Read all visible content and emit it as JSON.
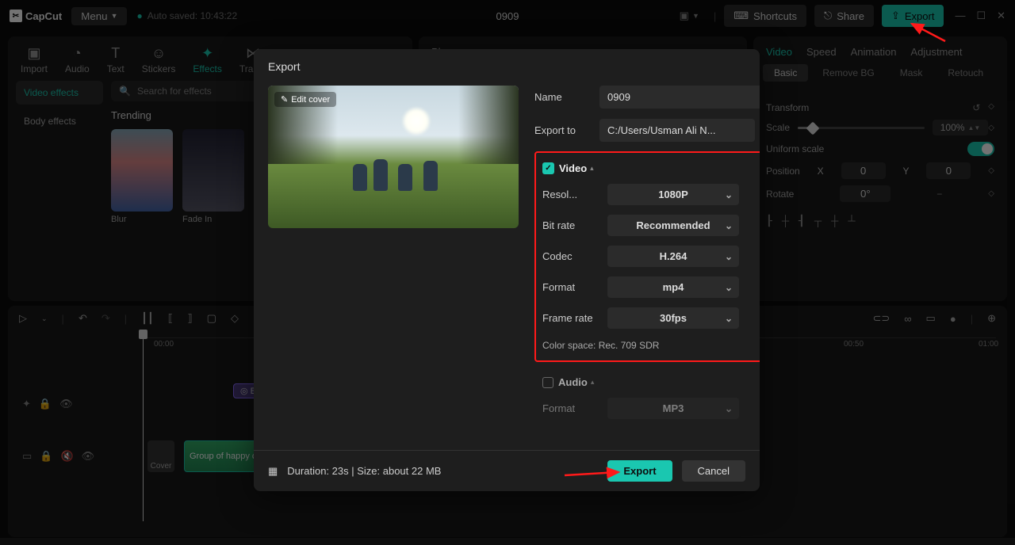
{
  "app": {
    "name": "CapCut",
    "menu": "Menu",
    "autosave": "Auto saved: 10:43:22",
    "title": "0909"
  },
  "topbar": {
    "shortcuts": "Shortcuts",
    "share": "Share",
    "export": "Export"
  },
  "left": {
    "tabs": {
      "import": "Import",
      "audio": "Audio",
      "text": "Text",
      "stickers": "Stickers",
      "effects": "Effects",
      "transitions": "Tran..."
    },
    "side_active": "Video effects",
    "side_body": "Body effects",
    "search_placeholder": "Search for effects",
    "trending": "Trending",
    "thumbs": [
      {
        "name": "blur",
        "label": "Blur"
      },
      {
        "name": "fade-in",
        "label": "Fade In"
      },
      {
        "name": "thumb3",
        "label": ""
      },
      {
        "name": "thumb4",
        "label": ""
      }
    ]
  },
  "player": {
    "label": "Player"
  },
  "right": {
    "tabs": {
      "video": "Video",
      "speed": "Speed",
      "animation": "Animation",
      "adjustment": "Adjustment"
    },
    "subtabs": {
      "basic": "Basic",
      "removebg": "Remove BG",
      "mask": "Mask",
      "retouch": "Retouch"
    },
    "transform": "Transform",
    "scale_label": "Scale",
    "scale_value": "100%",
    "uniform": "Uniform scale",
    "position": "Position",
    "pos_x": "0",
    "pos_y": "0",
    "x": "X",
    "y": "Y",
    "rotate": "Rotate",
    "rotate_val": "0°"
  },
  "timeline": {
    "times": [
      "00:00",
      "00:50",
      "01:00"
    ],
    "cover": "Cover",
    "clip_label": "Group of happy children",
    "pill": "Bl..."
  },
  "modal": {
    "title": "Export",
    "edit_cover": "Edit cover",
    "name_label": "Name",
    "name_value": "0909",
    "exportto_label": "Export to",
    "exportto_value": "C:/Users/Usman Ali N...",
    "video_title": "Video",
    "resolution_label": "Resol...",
    "resolution_value": "1080P",
    "bitrate_label": "Bit rate",
    "bitrate_value": "Recommended",
    "codec_label": "Codec",
    "codec_value": "H.264",
    "format_label": "Format",
    "format_value": "mp4",
    "framerate_label": "Frame rate",
    "framerate_value": "30fps",
    "colorspace": "Color space: Rec. 709 SDR",
    "audio_title": "Audio",
    "audio_format_label": "Format",
    "audio_format_value": "MP3",
    "footer_info": "Duration: 23s | Size: about 22 MB",
    "export_btn": "Export",
    "cancel_btn": "Cancel"
  }
}
